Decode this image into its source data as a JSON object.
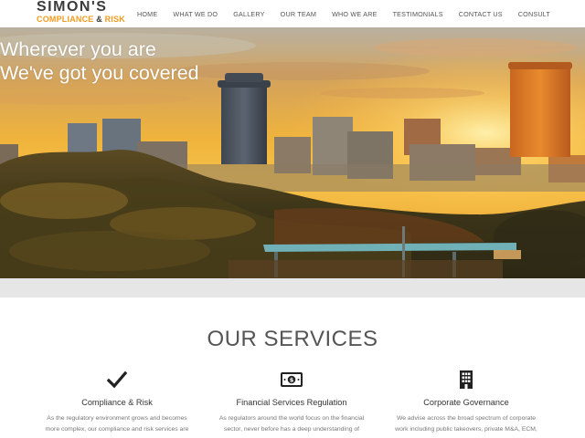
{
  "header": {
    "logo": {
      "name": "SIMON'S",
      "tag_part1": "COMPLIANCE",
      "tag_amp": "&",
      "tag_part2": "RISK"
    },
    "nav": [
      {
        "label": "HOME"
      },
      {
        "label": "WHAT WE DO"
      },
      {
        "label": "GALLERY"
      },
      {
        "label": "OUR TEAM"
      },
      {
        "label": "WHO WE ARE"
      },
      {
        "label": "TESTIMONIALS"
      },
      {
        "label": "CONTACT US"
      },
      {
        "label": "CONSULT"
      }
    ]
  },
  "hero": {
    "line1": "Wherever you are",
    "line2": "We've got you covered"
  },
  "services": {
    "title": "OUR SERVICES",
    "items": [
      {
        "icon": "checkmark-icon",
        "title": "Compliance & Risk",
        "desc_line1": "As the regulatory environment grows and becomes",
        "desc_line2": "more complex, our compliance and risk services are"
      },
      {
        "icon": "money-icon",
        "title": "Financial Services Regulation",
        "desc_line1": "As regulators around the world focus on the financial",
        "desc_line2": "sector, never before has a deep understanding of"
      },
      {
        "icon": "building-icon",
        "title": "Corporate Governance",
        "desc_line1": "We advise across the broad spectrum of corporate",
        "desc_line2": "work including public takeovers, private M&A, ECM,"
      }
    ]
  },
  "colors": {
    "accent": "#f29a1b",
    "logo_dark": "#3b3b3b",
    "nav_text": "#555555",
    "strip": "#e6e6e6"
  }
}
